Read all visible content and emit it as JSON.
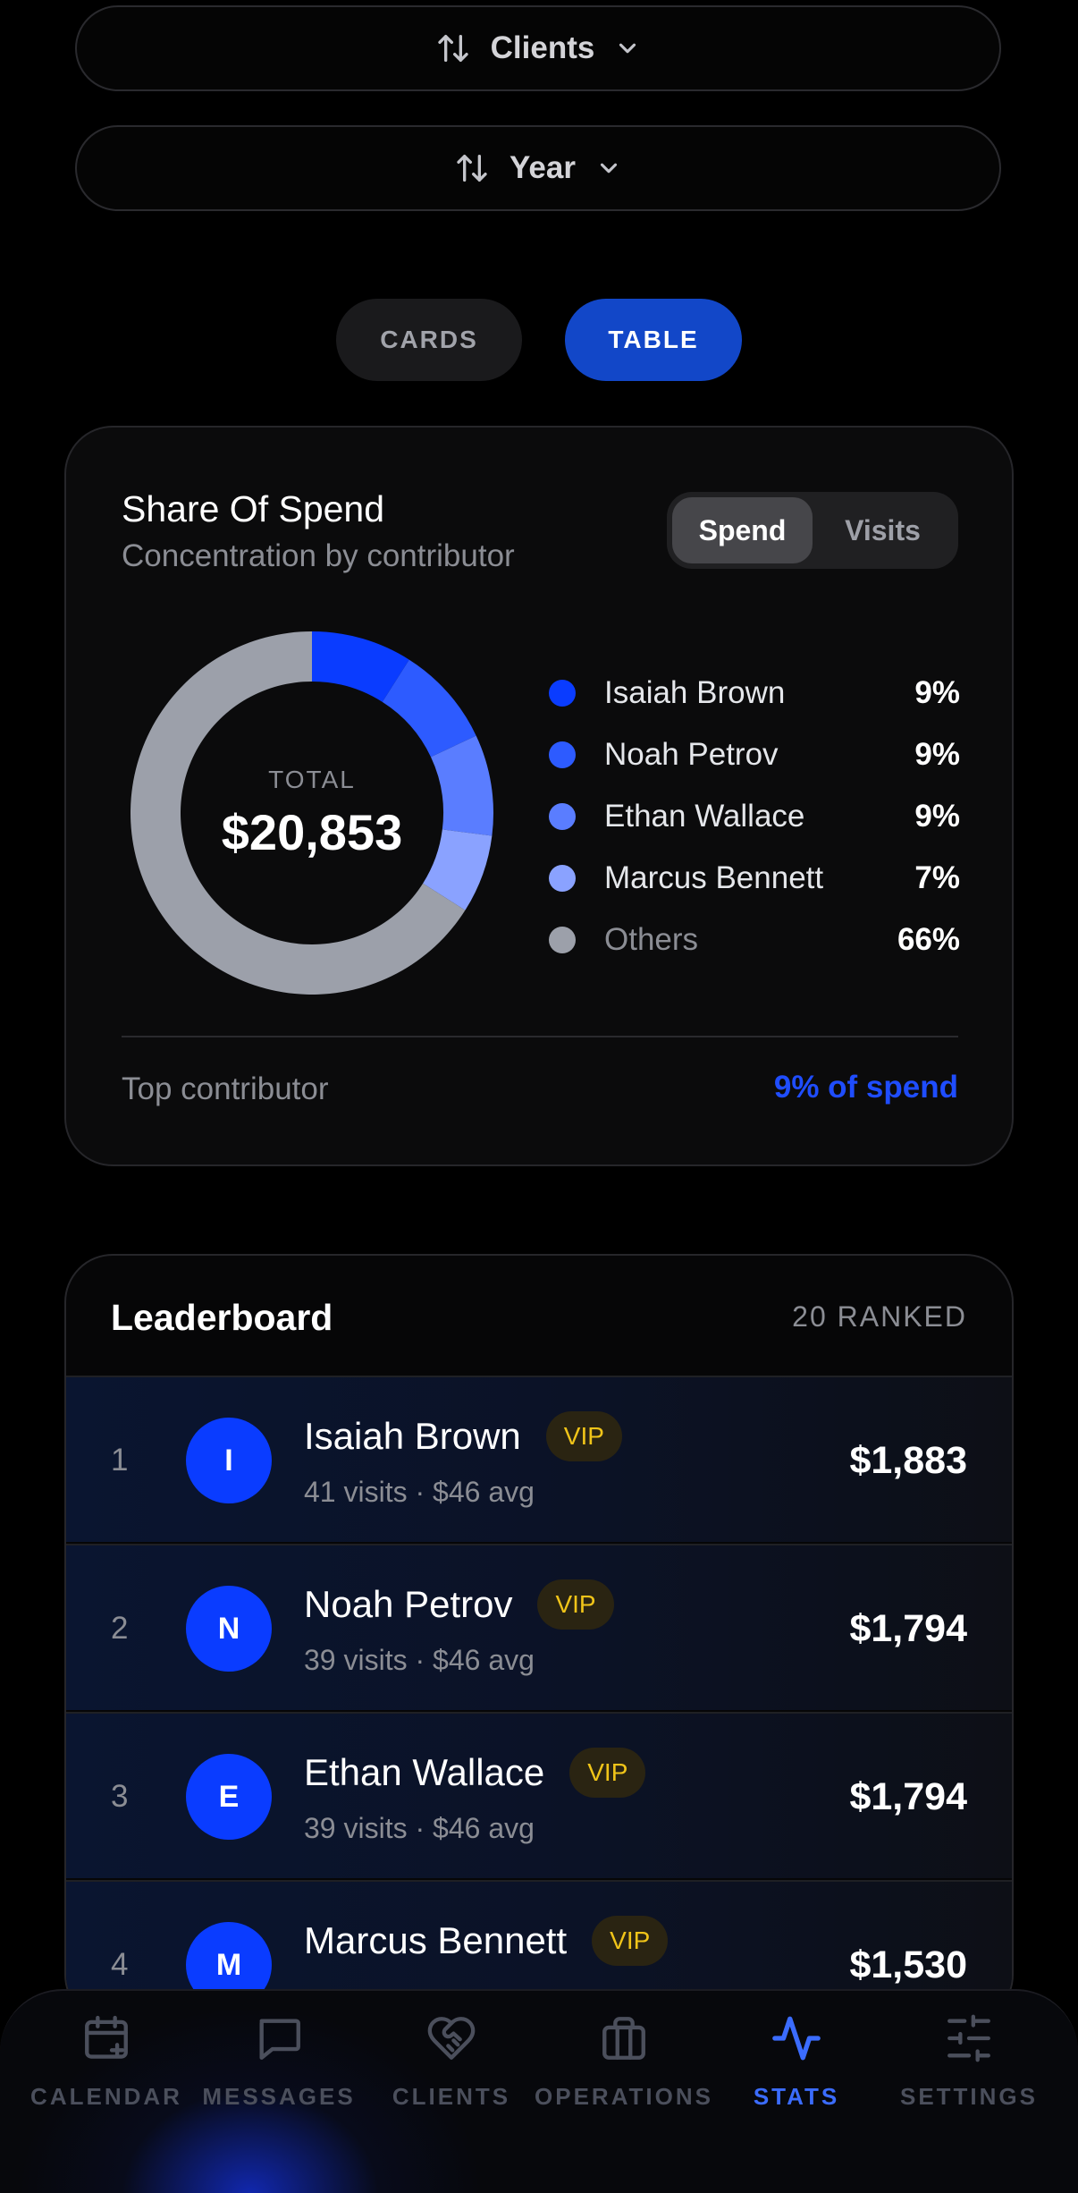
{
  "filters": [
    {
      "label": "Clients",
      "sort_icon": "sort-arrows-icon",
      "chevron_icon": "chevron-down-icon"
    },
    {
      "label": "Year",
      "sort_icon": "sort-arrows-icon",
      "chevron_icon": "chevron-down-icon"
    }
  ],
  "view_toggle": {
    "cards": "CARDS",
    "table": "TABLE",
    "active": "TABLE"
  },
  "share": {
    "title": "Share Of Spend",
    "subtitle": "Concentration by contributor",
    "toggle": {
      "spend": "Spend",
      "visits": "Visits",
      "active": "Spend"
    },
    "total_label": "TOTAL",
    "total_value": "$20,853",
    "legend": [
      {
        "name": "Isaiah Brown",
        "pct": "9%",
        "color": "#0a3cff"
      },
      {
        "name": "Noah Petrov",
        "pct": "9%",
        "color": "#2d5bff"
      },
      {
        "name": "Ethan Wallace",
        "pct": "9%",
        "color": "#5a7dff"
      },
      {
        "name": "Marcus Bennett",
        "pct": "7%",
        "color": "#8aa2ff"
      },
      {
        "name": "Others",
        "pct": "66%",
        "color": "#9ca0aa"
      }
    ],
    "footer_label": "Top contributor",
    "footer_value": "9% of spend"
  },
  "chart_data": {
    "type": "pie",
    "title": "Share Of Spend",
    "subtitle": "Concentration by contributor",
    "categories": [
      "Isaiah Brown",
      "Noah Petrov",
      "Ethan Wallace",
      "Marcus Bennett",
      "Others"
    ],
    "values": [
      9,
      9,
      9,
      7,
      66
    ],
    "colors": [
      "#0a3cff",
      "#2d5bff",
      "#5a7dff",
      "#8aa2ff",
      "#9ca0aa"
    ],
    "center_label": "TOTAL",
    "center_value": "$20,853",
    "legend": "right"
  },
  "leaderboard": {
    "title": "Leaderboard",
    "count": "20 RANKED",
    "rows": [
      {
        "rank": "1",
        "initial": "I",
        "name": "Isaiah Brown",
        "badge": "VIP",
        "meta": "41 visits · $46 avg",
        "amount": "$1,883"
      },
      {
        "rank": "2",
        "initial": "N",
        "name": "Noah Petrov",
        "badge": "VIP",
        "meta": "39 visits · $46 avg",
        "amount": "$1,794"
      },
      {
        "rank": "3",
        "initial": "E",
        "name": "Ethan Wallace",
        "badge": "VIP",
        "meta": "39 visits · $46 avg",
        "amount": "$1,794"
      },
      {
        "rank": "4",
        "initial": "M",
        "name": "Marcus Bennett",
        "badge": "VIP",
        "meta": "",
        "amount": "$1,530"
      }
    ]
  },
  "tabbar": {
    "active": "STATS",
    "accent": "#3b6cff",
    "items": [
      {
        "label": "CALENDAR",
        "icon": "calendar-add-icon"
      },
      {
        "label": "MESSAGES",
        "icon": "message-bubble-icon"
      },
      {
        "label": "CLIENTS",
        "icon": "heart-handshake-icon"
      },
      {
        "label": "OPERATIONS",
        "icon": "briefcase-icon"
      },
      {
        "label": "STATS",
        "icon": "activity-pulse-icon"
      },
      {
        "label": "SETTINGS",
        "icon": "sliders-icon"
      }
    ]
  }
}
